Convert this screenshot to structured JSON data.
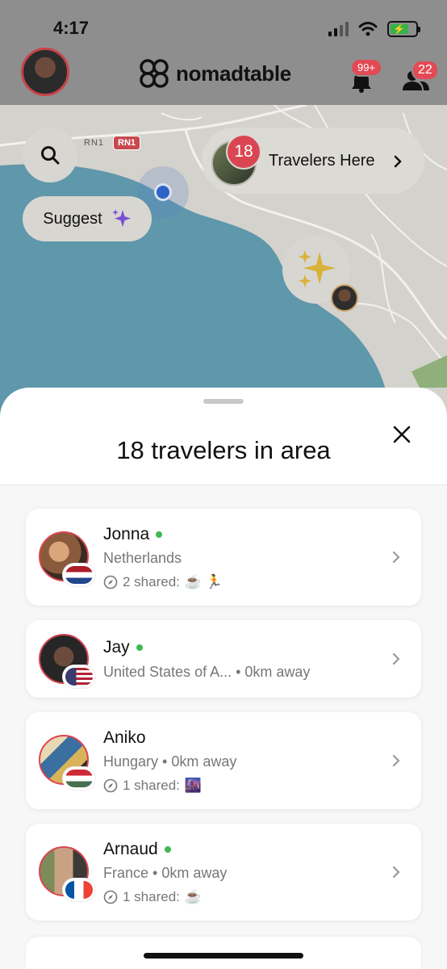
{
  "status_bar": {
    "time": "4:17",
    "battery_charging_symbol": "⚡"
  },
  "header": {
    "brand": "nomadtable",
    "notifications_badge": "99+",
    "friends_badge": "22",
    "icons": [
      "profile-avatar",
      "nomadtable-logo-icon",
      "bell-icon",
      "people-icon"
    ]
  },
  "map": {
    "road_label": "RN1",
    "road_sign": "RN1",
    "suggest_label": "Suggest",
    "travelers_here": {
      "count": "18",
      "label": "Travelers Here"
    },
    "icons": [
      "search-icon",
      "sparkle-icon",
      "location-dot-icon",
      "chevron-right-icon"
    ]
  },
  "sheet": {
    "title": "18 travelers in area",
    "travelers": [
      {
        "name": "Jonna",
        "online": true,
        "location": "Netherlands",
        "shared": "2 shared:",
        "shared_emojis": "☕ 🏃",
        "flag": "nl"
      },
      {
        "name": "Jay",
        "online": true,
        "location": "United States of A... • 0km away",
        "shared": "",
        "shared_emojis": "",
        "flag": "us"
      },
      {
        "name": "Aniko",
        "online": false,
        "location": "Hungary • 0km away",
        "shared": "1 shared:",
        "shared_emojis": "🌆",
        "flag": "hu"
      },
      {
        "name": "Arnaud",
        "online": true,
        "location": "France • 0km away",
        "shared": "1 shared:",
        "shared_emojis": "☕",
        "flag": "fr"
      }
    ]
  },
  "colors": {
    "accent": "#d94651",
    "online": "#3fb950",
    "water": "#6ba3ba",
    "land": "#e6e3dc"
  }
}
